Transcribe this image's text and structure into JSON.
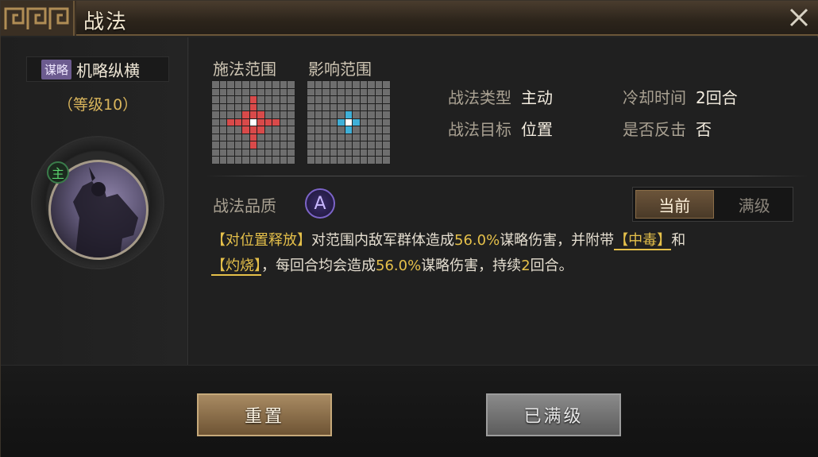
{
  "window": {
    "title": "战法"
  },
  "skill": {
    "tag": "谋略",
    "name": "机略纵横",
    "level_text": "（等级10）",
    "portrait_badge": "主"
  },
  "ranges": {
    "cast_title": "施法范围",
    "effect_title": "影响范围"
  },
  "info": {
    "type_label": "战法类型",
    "type_value": "主动",
    "cooldown_label": "冷却时间",
    "cooldown_value": "2回合",
    "target_label": "战法目标",
    "target_value": "位置",
    "counter_label": "是否反击",
    "counter_value": "否"
  },
  "quality": {
    "label": "战法品质",
    "grade": "A"
  },
  "toggle": {
    "current": "当前",
    "max": "满级"
  },
  "description": {
    "p1": "【对位置释放】",
    "p2": "对范围内敌军群体造成",
    "p3": "56.0%",
    "p4": "谋略伤害，并附带",
    "p5": "【中毒】",
    "p6": "和",
    "p7": "【灼烧】",
    "p8": "，每回合均会造成",
    "p9": "56.0%",
    "p10": "谋略伤害，持续",
    "p11": "2",
    "p12": "回合。"
  },
  "buttons": {
    "reset": "重置",
    "maxed": "已满级"
  },
  "colors": {
    "accent_gold": "#e5c04a",
    "quality_purple": "#7c64c8",
    "cast_red": "#d94a4a",
    "effect_blue": "#3fb0d8"
  },
  "icons": {
    "close": "close-icon",
    "title_ornament": "cloud-scroll-ornament"
  }
}
